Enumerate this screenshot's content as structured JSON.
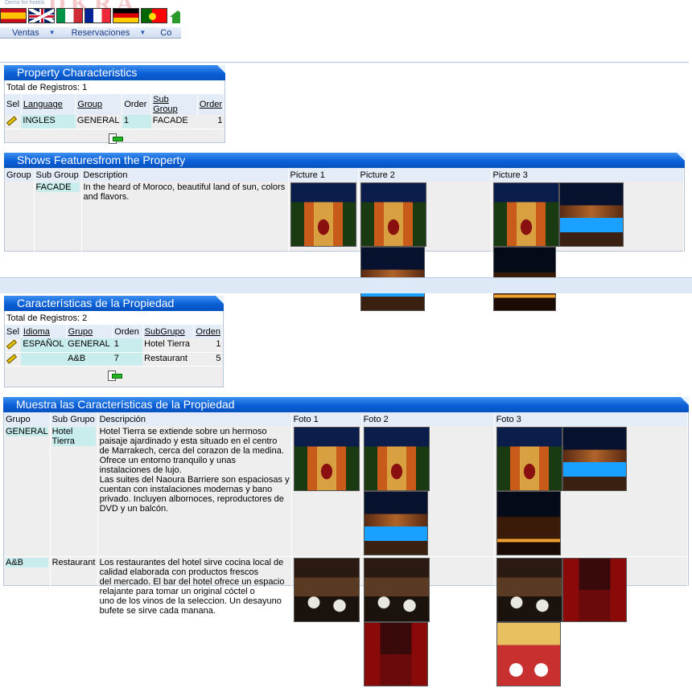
{
  "header": {
    "demo_text": "Demo for hotels",
    "flags": [
      "flag-spain",
      "flag-uk",
      "flag-italy",
      "flag-france",
      "flag-germany",
      "flag-portugal"
    ],
    "menu": [
      "Ventas",
      "Reservaciones",
      "Co"
    ]
  },
  "panel1": {
    "title": "Property Characteristics",
    "total": "Total de Registros: 1",
    "columns": [
      "Sel",
      "Language",
      "Group",
      "Order",
      "Sub Group",
      "Order"
    ],
    "rows": [
      {
        "language": "INGLES",
        "group": "GENERAL",
        "order": "1",
        "subgroup": "FACADE",
        "order2": "1"
      }
    ]
  },
  "panel2": {
    "title": "Shows Featuresfrom the Property",
    "columns": [
      "Group",
      "Sub Group",
      "Description",
      "Picture 1",
      "Picture 2",
      "Picture 3"
    ],
    "row": {
      "group": "",
      "subgroup": "FACADE",
      "description": "In the heard of Moroco, beautiful land of sun, colors and flavors."
    }
  },
  "panel3": {
    "title": "Características de la Propiedad",
    "total": "Total de Registros: 2",
    "columns": [
      "Sel",
      "Idioma",
      "Grupo",
      "Orden",
      "SubGrupo",
      "Orden"
    ],
    "rows": [
      {
        "idioma": "ESPAÑOL",
        "grupo": "GENERAL",
        "orden": "1",
        "subgrupo": "Hotel Tierra",
        "orden2": "1"
      },
      {
        "idioma": "",
        "grupo": "A&B",
        "orden": "7",
        "subgrupo": "Restaurant",
        "orden2": "5"
      }
    ]
  },
  "panel4": {
    "title": "Muestra las Características de la Propiedad",
    "columns": [
      "Grupo",
      "Sub Grupo",
      "Descripción",
      "Foto 1",
      "Foto 2",
      "Foto 3"
    ],
    "rows": [
      {
        "grupo": "GENERAL",
        "subgrupo": "Hotel Tierra",
        "descripcion": "Hotel Tierra se extiende sobre un hermoso paisaje ajardinado y esta situado en el centro de Marrakech, cerca del corazon de la medina. Ofrece un entorno tranquilo y unas instalaciones de lujo.\nLas suites del Naoura Barriere son espaciosas y cuentan con instalaciones modernas y bano privado. Incluyen albornoces, reproductores de DVD y un balcón."
      },
      {
        "grupo": "A&B",
        "subgrupo": "Restaurant",
        "descripcion": "Los restaurantes del hotel sirve cocina local de calidad elaborada con productos frescos\ndel mercado. El bar del hotel ofrece un espacio relajante para tomar un original cóctel o\nuno de los vinos de la seleccion. Un desayuno bufete se sirve cada manana."
      }
    ]
  }
}
